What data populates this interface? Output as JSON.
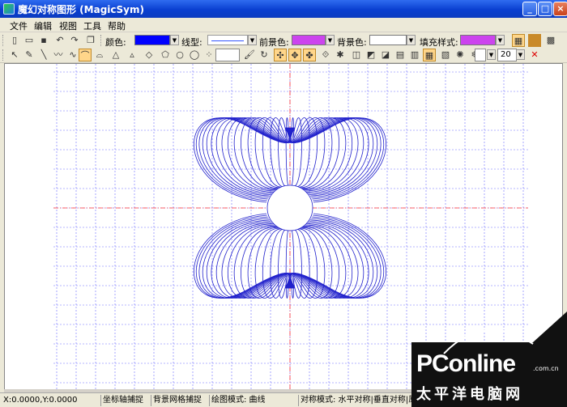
{
  "window": {
    "title": "魔幻对称图形 (MagicSym)",
    "buttons": [
      "minimize",
      "maximize",
      "close"
    ]
  },
  "menu": {
    "items": [
      "文件",
      "编辑",
      "视图",
      "工具",
      "帮助"
    ]
  },
  "toolbar1": {
    "color_label": "颜色:",
    "color_value": "#0000ff",
    "linestyle_label": "线型:",
    "fg_label": "前景色:",
    "fg_value": "#cc44ee",
    "bg_label": "背景色:",
    "fill_label": "填充样式:",
    "fill_value": "#cc44ee"
  },
  "toolbar2": {
    "spin_value": "20"
  },
  "canvas": {
    "axis_color": "#ff3333",
    "grid_color": "#6a6aff",
    "curve_color": "#2222cc"
  },
  "status": {
    "coords": "X:0.0000,Y:0.0000",
    "axis_snap": "坐标轴捕捉",
    "grid_snap": "背景网格捕捉",
    "draw_mode": "绘图模式: 曲线",
    "sym_mode": "对称模式: 水平对称|垂直对称|原点"
  },
  "watermark": {
    "brand": "PConline",
    "domain": ".com.cn",
    "tagline": "太平洋电脑网"
  }
}
